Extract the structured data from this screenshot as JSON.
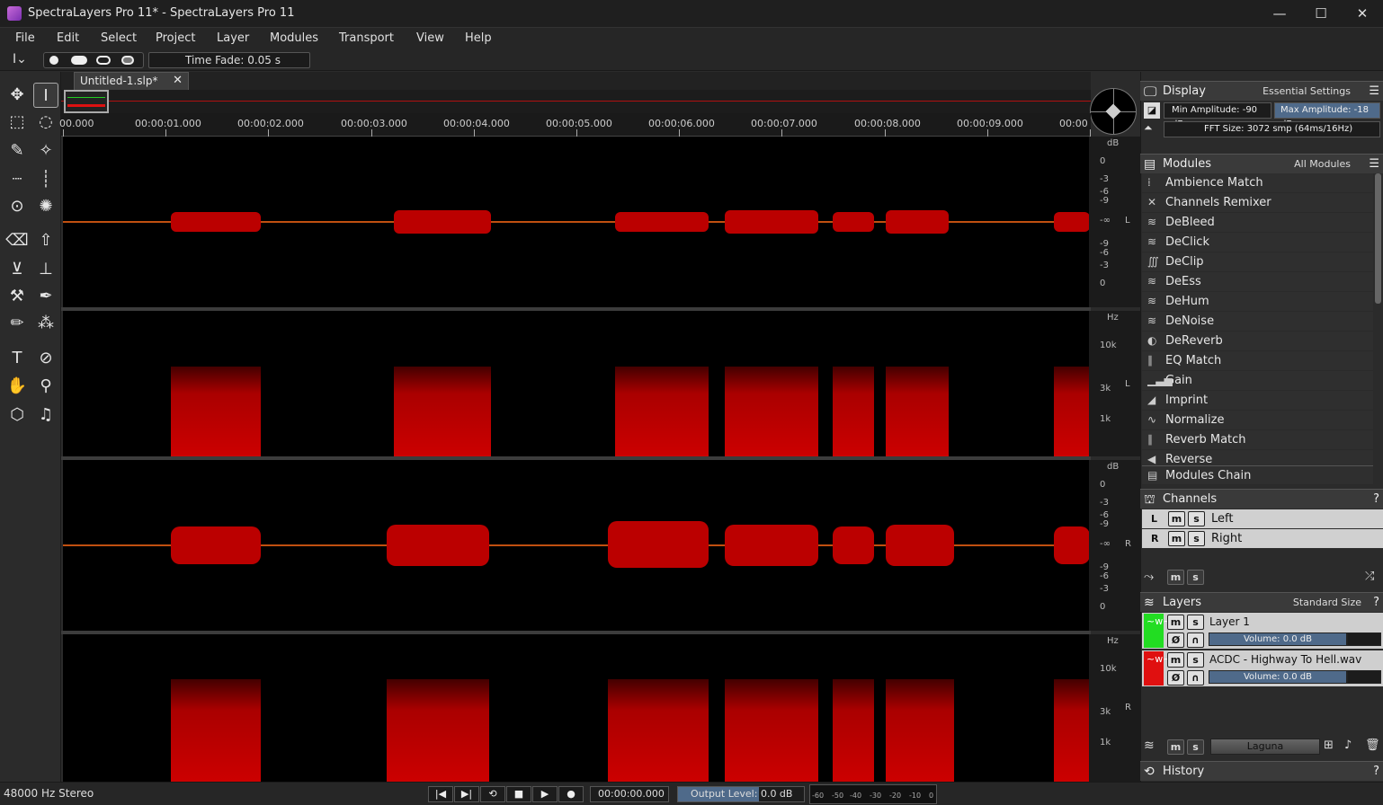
{
  "window": {
    "title": "SpectraLayers Pro 11* - SpectraLayers Pro 11",
    "min": "—",
    "max": "☐",
    "close": "✕"
  },
  "menu": [
    "File",
    "Edit",
    "Select",
    "Project",
    "Layer",
    "Modules",
    "Transport",
    "View",
    "Help"
  ],
  "toolopts": {
    "time_fade": "Time Fade: 0.05 s"
  },
  "tab": {
    "label": "Untitled-1.slp*",
    "close": "✕"
  },
  "ruler": [
    "00.000",
    "00:00:01.000",
    "00:00:02.000",
    "00:00:03.000",
    "00:00:04.000",
    "00:00:05.000",
    "00:00:06.000",
    "00:00:07.000",
    "00:00:08.000",
    "00:00:09.000",
    "00:00"
  ],
  "scales": {
    "db_unit": "dB",
    "hz_unit": "Hz",
    "db_ticks": [
      "0",
      "-3",
      "-6",
      "-9",
      "-∞",
      "-9",
      "-6",
      "-3",
      "0"
    ],
    "hz_ticks": [
      "10k",
      "3k",
      "1k"
    ],
    "left": "L",
    "right": "R"
  },
  "display": {
    "title": "Display",
    "preset": "Essential Settings",
    "min_amp": "Min Amplitude: -90 dB",
    "max_amp": "Max Amplitude: -18 dB",
    "fft": "FFT Size: 3072 smp (64ms/16Hz)"
  },
  "modules": {
    "title": "Modules",
    "filter": "All Modules",
    "items": [
      "Ambience Match",
      "Channels Remixer",
      "DeBleed",
      "DeClick",
      "DeClip",
      "DeEss",
      "DeHum",
      "DeNoise",
      "DeReverb",
      "EQ Match",
      "Gain",
      "Imprint",
      "Normalize",
      "Reverb Match",
      "Reverse"
    ],
    "chain": "Modules Chain"
  },
  "channels": {
    "title": "Channels",
    "items": [
      {
        "id": "L",
        "name": "Left"
      },
      {
        "id": "R",
        "name": "Right"
      }
    ],
    "m": "m",
    "s": "s"
  },
  "layers": {
    "title": "Layers",
    "size": "Standard Size",
    "items": [
      {
        "name": "Layer 1",
        "volume": "Volume: 0.0 dB",
        "color": "#22dd22"
      },
      {
        "name": "ACDC - Highway To Hell.wav",
        "volume": "Volume: 0.0 dB",
        "color": "#e01010"
      }
    ],
    "blend": "Laguna"
  },
  "history": {
    "title": "History"
  },
  "status": {
    "format": "48000 Hz Stereo",
    "time": "00:00:00.000",
    "output": "Output Level: 0.0 dB",
    "meter": [
      "-60",
      "-50",
      "-40",
      "-30",
      "-20",
      "-10",
      "0"
    ]
  },
  "help": "?"
}
